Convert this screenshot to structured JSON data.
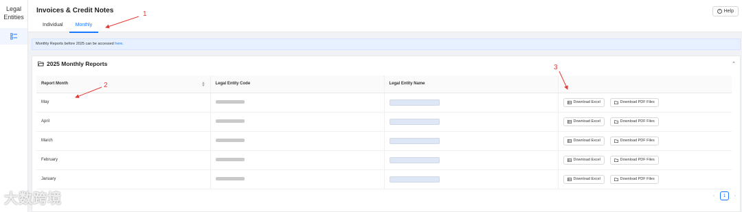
{
  "sidebar": {
    "title_line1": "Legal",
    "title_line2": "Entities",
    "nav_icon": "list-icon"
  },
  "header": {
    "title": "Invoices & Credit Notes",
    "tabs": [
      {
        "label": "Individual"
      },
      {
        "label": "Monthly"
      }
    ],
    "help_label": "Help"
  },
  "notice": {
    "text": "Monthly Reports before 2025 can be accessed ",
    "link": "here."
  },
  "section": {
    "title": "2025 Monthly Reports",
    "columns": [
      "Report Month",
      "Legal Entity Code",
      "Legal Entity Name",
      ""
    ],
    "rows": [
      {
        "month": "May"
      },
      {
        "month": "April"
      },
      {
        "month": "March"
      },
      {
        "month": "February"
      },
      {
        "month": "January"
      }
    ],
    "excel_label": "Download Excel",
    "pdf_label": "Download PDF Files"
  },
  "pagination": {
    "prev": "‹",
    "current": "1",
    "next": "›"
  },
  "annotations": {
    "a1": "1",
    "a2": "2",
    "a3": "3"
  },
  "watermark": "大数跨境",
  "colors": {
    "accent": "#1677ff",
    "annotation": "#e53935"
  }
}
